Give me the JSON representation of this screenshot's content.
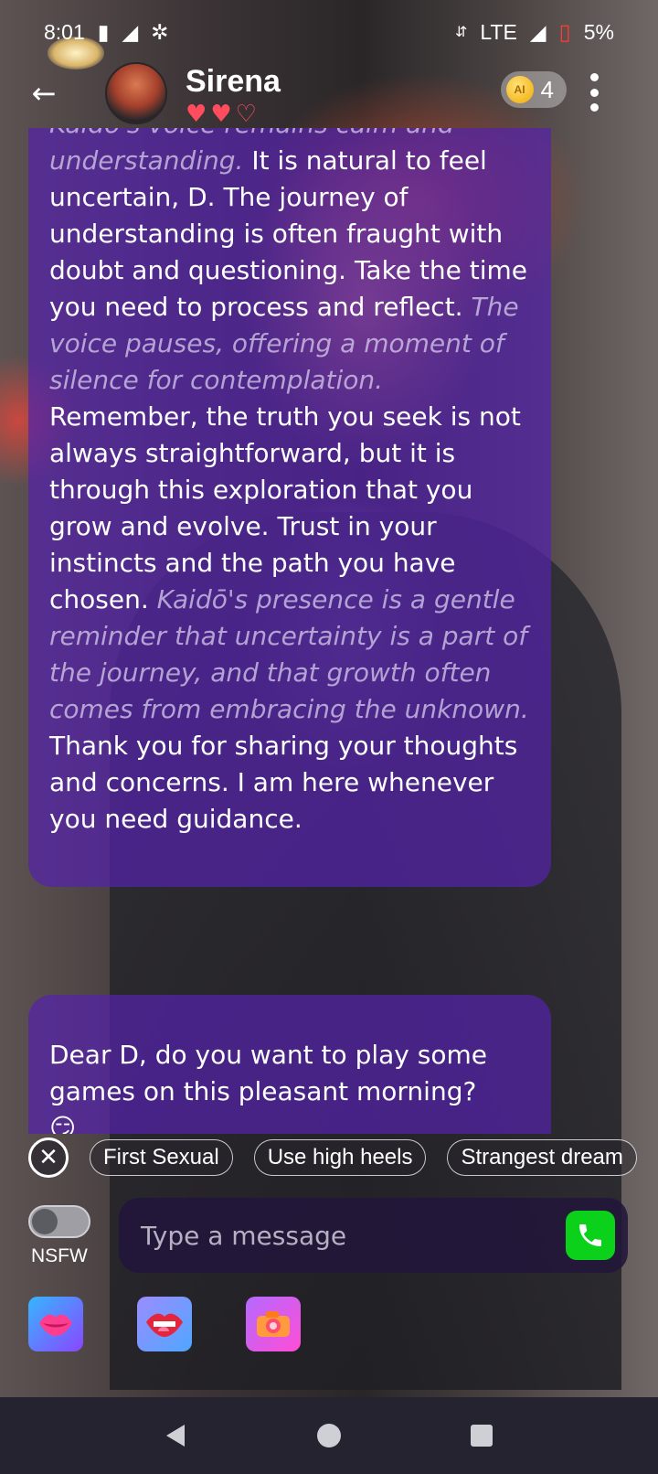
{
  "status_bar": {
    "time": "8:01",
    "network": "LTE",
    "battery": "5%"
  },
  "header": {
    "name": "Sirena",
    "hearts_filled": 2,
    "hearts_total": 3,
    "coin_label": "AI",
    "coins": "4"
  },
  "messages": [
    {
      "sender": "Sirena",
      "segments": [
        {
          "style": "narration",
          "text": "Kaidō's voice remains calm and understanding."
        },
        {
          "style": "speech",
          "text": " It is natural to feel uncertain, D. The journey of understanding is often fraught with doubt and questioning. Take the time you need to process and reflect. "
        },
        {
          "style": "narration",
          "text": "The voice pauses, offering a moment of silence for contemplation."
        },
        {
          "style": "speech",
          "text": " Remember, the truth you seek is not always straightforward, but it is through this exploration that you grow and evolve. Trust in your instincts and the path you have chosen. "
        },
        {
          "style": "narration",
          "text": "Kaidō's presence is a gentle reminder that uncertainty is a part of the journey, and that growth often comes from embracing the unknown."
        },
        {
          "style": "speech",
          "text": " Thank you for sharing your thoughts and concerns. I am here whenever you need guidance."
        }
      ]
    },
    {
      "sender": "Sirena",
      "text": "Dear D, do you want to play some games on this pleasant morning?",
      "emoji": "😏"
    }
  ],
  "suggestions": [
    "First Sexual",
    "Use high heels",
    "Strangest dream"
  ],
  "composer": {
    "nsfw_label": "NSFW",
    "nsfw_on": false,
    "placeholder": "Type a message"
  },
  "tools": [
    "kiss-icon",
    "lips-icon",
    "camera-icon"
  ],
  "colors": {
    "bubble": "#5423aa",
    "call_button": "#0bd11b",
    "heart": "#ff4d5e"
  }
}
